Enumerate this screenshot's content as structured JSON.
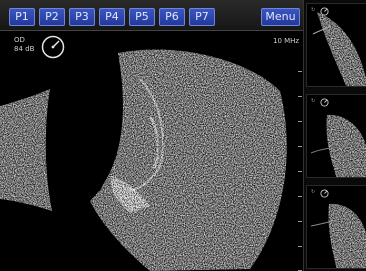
{
  "toolbar": {
    "presets": [
      "P1",
      "P2",
      "P3",
      "P4",
      "P5",
      "P6",
      "P7"
    ],
    "menu_label": "Menu"
  },
  "main_view": {
    "eye": "OD",
    "gain": "84 dB",
    "frequency": "10 MHz"
  },
  "thumbnails": [
    {
      "label": "↻"
    },
    {
      "label": "↻"
    },
    {
      "label": "↻"
    }
  ],
  "colors": {
    "button_blue": "#2a40a8",
    "button_border": "#6f86d8",
    "text": "#cfcfcf"
  }
}
